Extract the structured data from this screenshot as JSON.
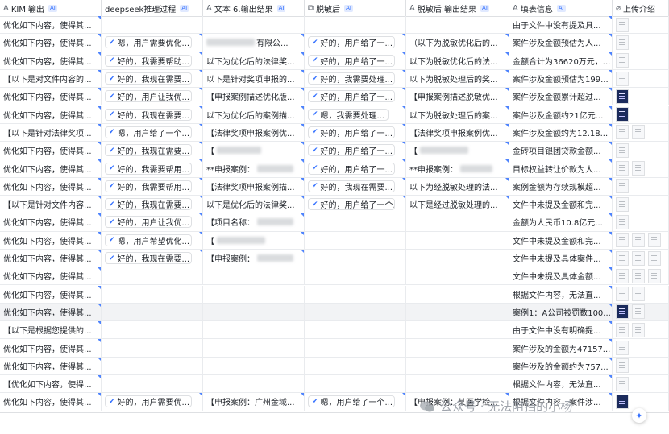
{
  "columns": [
    {
      "key": "kimi",
      "title": "KIMI输出",
      "icon": "text-type-icon",
      "icon_glyph": "A",
      "ai": "AI"
    },
    {
      "key": "ds",
      "title": "deepseek推理过程",
      "icon": "",
      "icon_glyph": "",
      "ai": "AI"
    },
    {
      "key": "t6",
      "title": "文本 6.输出结果",
      "icon": "text-type-icon",
      "icon_glyph": "A",
      "ai": "AI"
    },
    {
      "key": "tm",
      "title": "脱敏后",
      "icon": "link-copy-icon",
      "icon_glyph": "⧉",
      "ai": "AI"
    },
    {
      "key": "tmr",
      "title": "脱敏后.输出结果",
      "icon": "text-type-icon",
      "icon_glyph": "A",
      "ai": "AI"
    },
    {
      "key": "fill",
      "title": "填表信息",
      "icon": "text-type-icon",
      "icon_glyph": "A",
      "ai": "AI"
    },
    {
      "key": "up",
      "title": "上传介绍",
      "icon": "attachment-icon",
      "icon_glyph": "⌀",
      "ai": ""
    }
  ],
  "rows": [
    {
      "kimi": "优化如下内容，使得其...",
      "ds": "",
      "t6": "",
      "tm": "",
      "tmr": "",
      "fill": "由于文件中没有提及具...",
      "thumbs": [
        "doc"
      ]
    },
    {
      "kimi": "优化如下内容，使得其...",
      "ds": "嗯，用户需要优化...",
      "t6": "有限公...",
      "tm": "好的，用户给了一...",
      "tmr": "（以下为脱敏优化后的...",
      "fill": "案件涉及金额预估为人...",
      "thumbs": [
        "doc"
      ]
    },
    {
      "kimi": "优化如下内容，使得其...",
      "ds": "好的，我需要帮助...",
      "t6": "以下为优化后的法律奖...",
      "tm": "好的，用户给了一...",
      "tmr": "以下为脱敏优化后的法...",
      "fill": "金额合计为36620万元，...",
      "thumbs": [
        "doc"
      ]
    },
    {
      "kimi": "【以下是对文件内容的...",
      "ds": "好的，我现在需要...",
      "t6": "以下是针对奖项申报的...",
      "tm": "好的，我需要处理...",
      "tmr": "以下为脱敏处理后的奖...",
      "fill": "案件涉及金额预估为199...",
      "thumbs": [
        "doc"
      ]
    },
    {
      "kimi": "优化如下内容，使得其...",
      "ds": "好的，用户让我优...",
      "t6": "【申报案例描述优化版...",
      "tm": "好的，用户给了一...",
      "tmr": "【申报案例描述脱敏优...",
      "fill": "案件涉及金额累计超过...",
      "thumbs": [
        "dark"
      ]
    },
    {
      "kimi": "优化如下内容，使得其...",
      "ds": "好的，我现在需要...",
      "t6": "以下为优化后的案例描...",
      "tm": "嗯，我需要处理...",
      "tmr": "以下为脱敏处理后的案...",
      "fill": "案件涉及金额约21亿元...",
      "thumbs": [
        "dark"
      ]
    },
    {
      "kimi": "【以下是针对法律奖项...",
      "ds": "嗯，用户给了一个...",
      "t6": "【法律奖项申报案例优...",
      "tm": "好的，用户给了一...",
      "tmr": "【法律奖项申报案例优...",
      "fill": "案件涉及金额约为12.18...",
      "thumbs": [
        "doc",
        "doc"
      ]
    },
    {
      "kimi": "优化如下内容，使得其...",
      "ds": "好的，我现在需要...",
      "t6": "【",
      "tm": "好的，用户给了一...",
      "tmr": "【",
      "fill": "金砖项目银团贷款金额...",
      "thumbs": [
        "doc"
      ]
    },
    {
      "kimi": "优化如下内容，使得其...",
      "ds": "好的，我需要帮用...",
      "t6": "**申报案例：",
      "tm": "好的，用户给了一...",
      "tmr": "**申报案例：",
      "fill": "目标权益转让价款为人...",
      "thumbs": [
        "doc",
        "doc"
      ]
    },
    {
      "kimi": "优化如下内容，使得其...",
      "ds": "好的，我需要帮用...",
      "t6": "【法律奖项申报案例描...",
      "tm": "好的，我现在需要...",
      "tmr": "以下为经脱敏处理的法...",
      "fill": "案例金额为存续规模超...",
      "thumbs": [
        "doc"
      ]
    },
    {
      "kimi": "【以下是针对文件内容...",
      "ds": "好的，我现在需要...",
      "t6": "以下是优化后的法律奖...",
      "tm": "好的，用户给了一个...",
      "tmr": "以下是经过脱敏处理的...",
      "fill": "文件中未提及金额和完...",
      "thumbs": [
        "doc"
      ]
    },
    {
      "kimi": "优化如下内容，使得其...",
      "ds": "好的，用户让我优...",
      "t6": "【项目名称：",
      "tm": "",
      "tmr": "",
      "fill": "金额为人民币10.8亿元...",
      "thumbs": [
        "doc"
      ]
    },
    {
      "kimi": "优化如下内容，使得其...",
      "ds": "嗯，用户希望优化...",
      "t6": "【",
      "tm": "",
      "tmr": "",
      "fill": "文件中未提及金额和完...",
      "thumbs": [
        "doc",
        "doc",
        "doc"
      ]
    },
    {
      "kimi": "优化如下内容，使得其...",
      "ds": "好的，我现在需要...",
      "t6": "【申报案例：",
      "tm": "",
      "tmr": "",
      "fill": "文件中未提及具体案件...",
      "thumbs": [
        "doc",
        "doc",
        "doc"
      ]
    },
    {
      "kimi": "优化如下内容，使得其...",
      "ds": "",
      "t6": "",
      "tm": "",
      "tmr": "",
      "fill": "文件中未提及具体金额...",
      "thumbs": [
        "doc",
        "doc",
        "doc"
      ]
    },
    {
      "kimi": "优化如下内容，使得其...",
      "ds": "",
      "t6": "",
      "tm": "",
      "tmr": "",
      "fill": "根据文件内容，无法直...",
      "thumbs": [
        "doc",
        "doc"
      ]
    },
    {
      "kimi": "优化如下内容，使得其...",
      "ds": "",
      "t6": "",
      "tm": "",
      "tmr": "",
      "fill": "案例1：A公司被罚数100...",
      "thumbs": [
        "dark",
        "doc"
      ]
    },
    {
      "kimi": "【以下是根据您提供的...",
      "ds": "",
      "t6": "",
      "tm": "",
      "tmr": "",
      "fill": "由于文件中没有明确提...",
      "thumbs": [
        "doc",
        "doc"
      ]
    },
    {
      "kimi": "优化如下内容，使得其...",
      "ds": "",
      "t6": "",
      "tm": "",
      "tmr": "",
      "fill": "案件涉及的金额为47157...",
      "thumbs": [
        "doc"
      ]
    },
    {
      "kimi": "优化如下内容，使得其...",
      "ds": "",
      "t6": "",
      "tm": "",
      "tmr": "",
      "fill": "案件涉及的金额约为757...",
      "thumbs": [
        "doc"
      ]
    },
    {
      "kimi": "【优化如下内容，使得...",
      "ds": "",
      "t6": "",
      "tm": "",
      "tmr": "",
      "fill": "根据文件内容，无法直...",
      "thumbs": [
        "doc"
      ]
    },
    {
      "kimi": "优化如下内容，使得其...",
      "ds": "好的，用户需要优...",
      "t6": "【申报案例：广州金域...",
      "tm": "嗯，用户给了一个...",
      "tmr": "【申报案例：某医学检...",
      "fill": "根据文件内容，案件涉...",
      "thumbs": [
        "dark"
      ]
    }
  ],
  "watermark": "公众号 · 无法阻挡的小杨",
  "colors": {
    "accent": "#3370ff",
    "border": "#dee0e3",
    "highlight": "#f2f3f5"
  }
}
